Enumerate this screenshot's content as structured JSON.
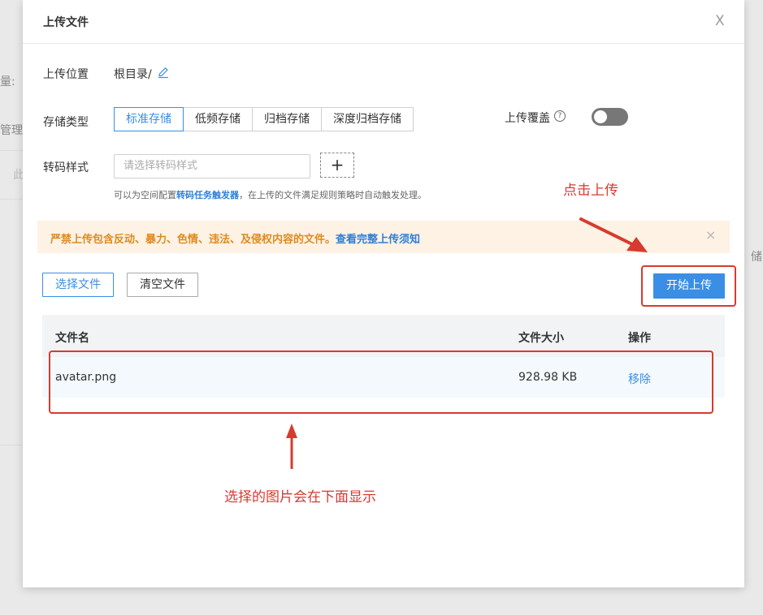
{
  "background": {
    "left_fragment_1": "量:",
    "left_fragment_2": "管理",
    "left_fragment_3": "此",
    "right_fragment": "储"
  },
  "dialog": {
    "title": "上传文件",
    "close_label": "X"
  },
  "upload_location": {
    "label": "上传位置",
    "value": "根目录/"
  },
  "storage_type": {
    "label": "存储类型",
    "options": [
      "标准存储",
      "低频存储",
      "归档存储",
      "深度归档存储"
    ],
    "selected": "标准存储"
  },
  "overwrite": {
    "label": "上传覆盖",
    "help": "?",
    "enabled": false
  },
  "transcode": {
    "label": "转码样式",
    "placeholder": "请选择转码样式",
    "add_label": "+",
    "hint_prefix": "可以为空间配置",
    "hint_link": "转码任务触发器",
    "hint_suffix": "，在上传的文件满足规则策略时自动触发处理。"
  },
  "warning": {
    "text": "严禁上传包含反动、暴力、色情、违法、及侵权内容的文件。",
    "link": "查看完整上传须知",
    "close_label": "×"
  },
  "actions": {
    "select_files": "选择文件",
    "clear_files": "清空文件",
    "start_upload": "开始上传"
  },
  "table": {
    "columns": [
      "文件名",
      "文件大小",
      "操作"
    ],
    "rows": [
      {
        "name": "avatar.png",
        "size": "928.98 KB",
        "action": "移除"
      }
    ]
  },
  "annotations": {
    "click_upload": "点击上传",
    "files_shown_below": "选择的图片会在下面显示",
    "color": "#d63b2f"
  },
  "colors": {
    "accent": "#3a8ee6",
    "warning_bg": "#fdf2e4",
    "warning_text": "#e08a1e"
  }
}
